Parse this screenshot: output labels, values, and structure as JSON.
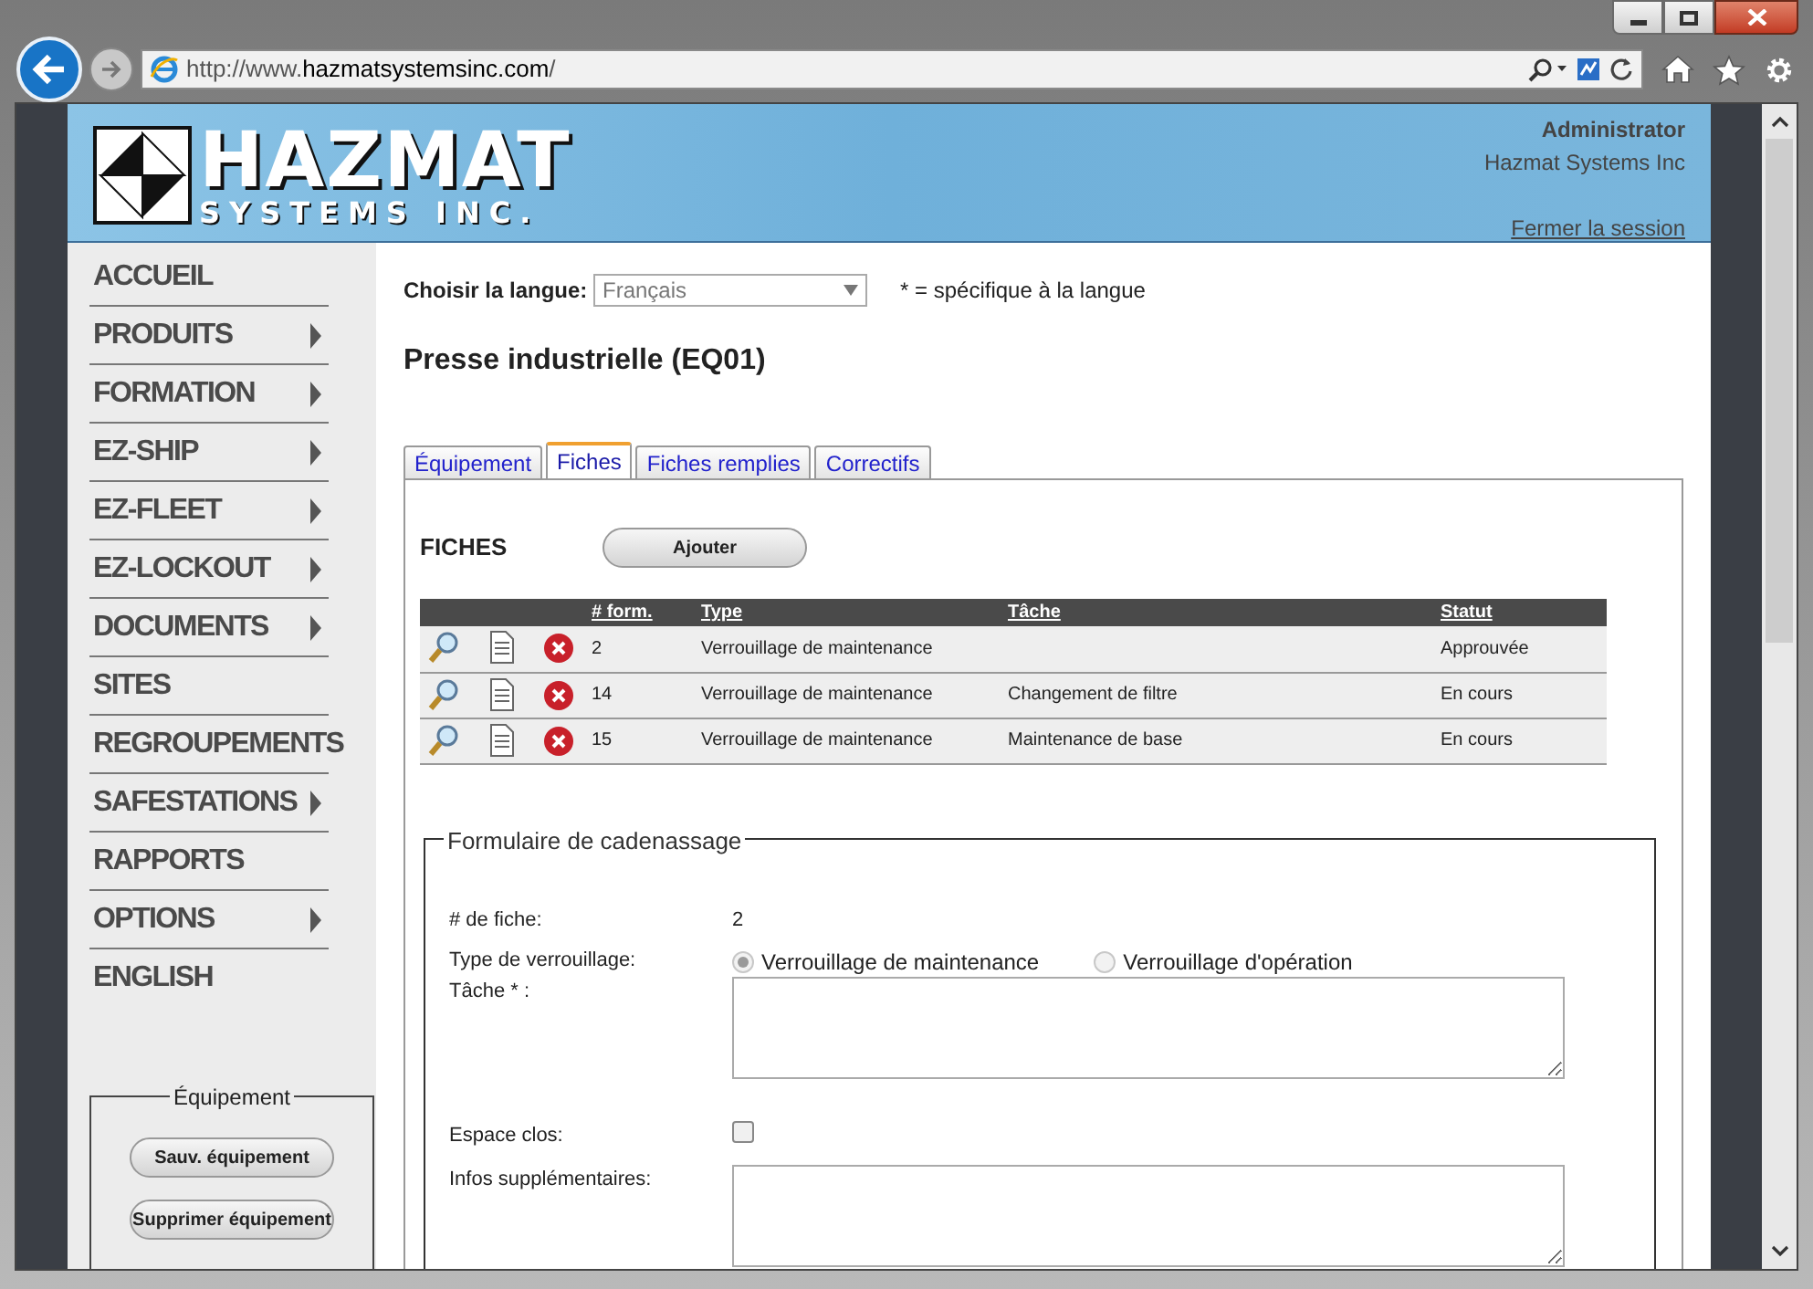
{
  "browser": {
    "url_prefix": "http://www.",
    "url_domain": "hazmatsystemsinc.com",
    "url_suffix": "/"
  },
  "header": {
    "logo_title": "HAZMAT",
    "logo_subtitle": "SYSTEMS INC.",
    "user": "Administrator",
    "company": "Hazmat Systems Inc",
    "logout": "Fermer la session"
  },
  "sidebar": {
    "items": [
      {
        "label": "ACCUEIL",
        "has_submenu": false
      },
      {
        "label": "PRODUITS",
        "has_submenu": true
      },
      {
        "label": "FORMATION",
        "has_submenu": true
      },
      {
        "label": "EZ-SHIP",
        "has_submenu": true
      },
      {
        "label": "EZ-FLEET",
        "has_submenu": true
      },
      {
        "label": "EZ-LOCKOUT",
        "has_submenu": true
      },
      {
        "label": "DOCUMENTS",
        "has_submenu": true
      },
      {
        "label": "SITES",
        "has_submenu": false
      },
      {
        "label": "REGROUPEMENTS",
        "has_submenu": false
      },
      {
        "label": "SAFESTATIONS",
        "has_submenu": true
      },
      {
        "label": "RAPPORTS",
        "has_submenu": false
      },
      {
        "label": "OPTIONS",
        "has_submenu": true
      },
      {
        "label": "ENGLISH",
        "has_submenu": false
      }
    ],
    "panel": {
      "legend": "Équipement",
      "buttons": [
        "Sauv. équipement",
        "Supprimer équipement"
      ]
    }
  },
  "language": {
    "label": "Choisir la langue:",
    "value": "Français",
    "note": "* = spécifique à la langue"
  },
  "title": "Presse industrielle (EQ01)",
  "tabs": [
    {
      "label": "Équipement",
      "selected": false
    },
    {
      "label": "Fiches",
      "selected": true
    },
    {
      "label": "Fiches remplies",
      "selected": false
    },
    {
      "label": "Correctifs",
      "selected": false
    }
  ],
  "fiches": {
    "heading": "FICHES",
    "add_button": "Ajouter",
    "columns": [
      "# form.",
      "Type",
      "Tâche",
      "Statut"
    ],
    "rows": [
      {
        "form": "2",
        "type": "Verrouillage de maintenance",
        "status": "Approuvée"
      },
      {
        "form": "14",
        "type": "Verrouillage de maintenance",
        "task": "Changement de filtre",
        "status": "En cours"
      },
      {
        "form": "15",
        "type": "Verrouillage de maintenance",
        "task": "Maintenance de base",
        "status": "En cours"
      }
    ]
  },
  "form": {
    "legend": "Formulaire de cadenassage",
    "fields": [
      {
        "kind": "text",
        "label": "# de fiche:",
        "value": "2"
      },
      {
        "kind": "radio",
        "label": "Type de verrouillage:",
        "options": [
          {
            "label": "Verrouillage de maintenance",
            "selected": true
          },
          {
            "label": "Verrouillage d'opération",
            "selected": false
          }
        ]
      },
      {
        "kind": "textarea",
        "label": "Tâche * :"
      },
      {
        "kind": "checkbox",
        "label": "Espace clos:",
        "checked": false
      },
      {
        "kind": "textarea",
        "label": "Infos supplémentaires:"
      }
    ]
  }
}
